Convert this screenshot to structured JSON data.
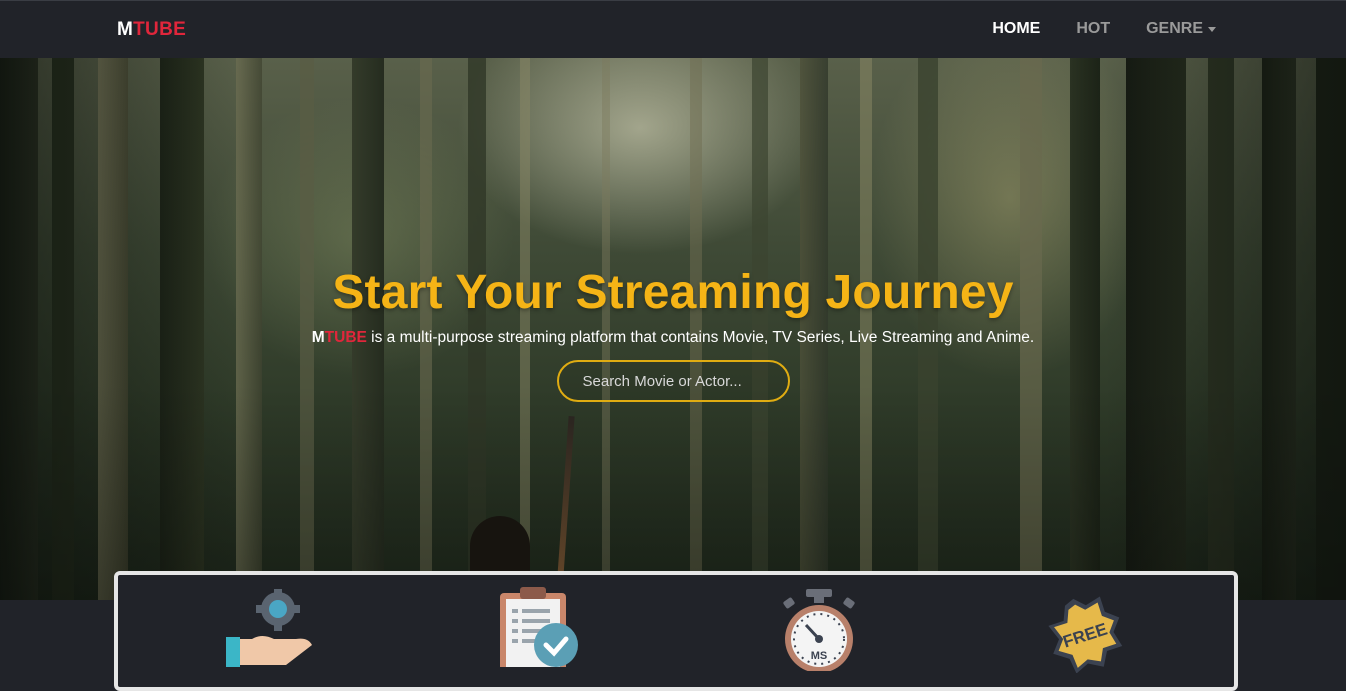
{
  "brand": {
    "first": "M",
    "rest": "TUBE"
  },
  "nav": {
    "home": "HOME",
    "hot": "HOT",
    "genre": "GENRE"
  },
  "hero": {
    "title": "Start Your Streaming Journey",
    "subtitle_brand_first": "M",
    "subtitle_brand_rest": "TUBE",
    "subtitle_text": " is a multi-purpose streaming platform that contains Movie, TV Series, Live Streaming and Anime.",
    "search_placeholder": "Search Movie or Actor..."
  },
  "features": {
    "icons": [
      "hand-gear-icon",
      "clipboard-check-icon",
      "stopwatch-icon",
      "free-badge-icon"
    ],
    "stopwatch_label": "MS",
    "free_label": "FREE"
  },
  "colors": {
    "accent": "#f5b416",
    "brand_red": "#e0263b",
    "nav_bg": "#212329"
  }
}
